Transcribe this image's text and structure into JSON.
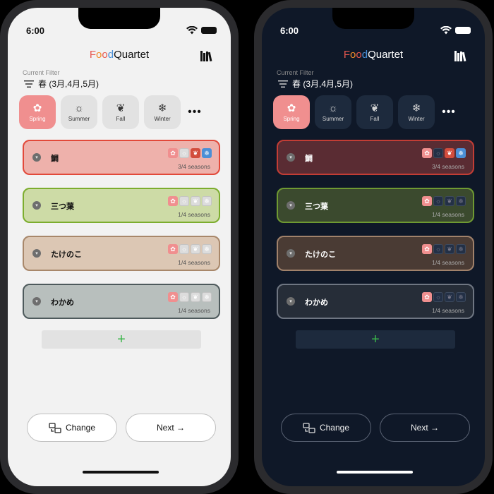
{
  "status": {
    "time": "6:00"
  },
  "app": {
    "title_letters": [
      "F",
      "o",
      "o",
      "d",
      "Quartet"
    ],
    "title_colors": [
      "#e8584f",
      "#f28c28",
      "#e8584f",
      "#4a8fd6"
    ]
  },
  "filter": {
    "label": "Current Filter",
    "value": "春 (3月,4月,5月)"
  },
  "seasons": [
    {
      "label": "Spring",
      "icon": "flower-icon",
      "glyph": "✿"
    },
    {
      "label": "Summer",
      "icon": "sun-icon",
      "glyph": "☼"
    },
    {
      "label": "Fall",
      "icon": "leaf-icon",
      "glyph": "❦"
    },
    {
      "label": "Winter",
      "icon": "snowflake-icon",
      "glyph": "❄"
    }
  ],
  "more": "•••",
  "foods": [
    {
      "name": "鯛",
      "seasons_text": "3/4 seasons",
      "seasons": [
        true,
        false,
        true,
        true
      ]
    },
    {
      "name": "三つ葉",
      "seasons_text": "1/4 seasons",
      "seasons": [
        true,
        false,
        false,
        false
      ]
    },
    {
      "name": "たけのこ",
      "seasons_text": "1/4 seasons",
      "seasons": [
        true,
        false,
        false,
        false
      ]
    },
    {
      "name": "わかめ",
      "seasons_text": "1/4 seasons",
      "seasons": [
        true,
        false,
        false,
        false
      ]
    }
  ],
  "add_button": "+",
  "buttons": {
    "change": "Change",
    "next": "Next →"
  },
  "colors": {
    "light_cards": [
      {
        "bg": "#eeb1ab",
        "border": "#e2493a"
      },
      {
        "bg": "#cddba6",
        "border": "#7cad2e"
      },
      {
        "bg": "#dcc7b4",
        "border": "#a8876a"
      },
      {
        "bg": "#b8bfbd",
        "border": "#4e5a5c"
      }
    ],
    "dark_cards": [
      {
        "bg": "#5a2c33",
        "border": "#c33d35"
      },
      {
        "bg": "#3b4a2e",
        "border": "#6f9a32"
      },
      {
        "bg": "#4a3b34",
        "border": "#a1826b"
      },
      {
        "bg": "#262d38",
        "border": "#6f7682"
      }
    ]
  }
}
